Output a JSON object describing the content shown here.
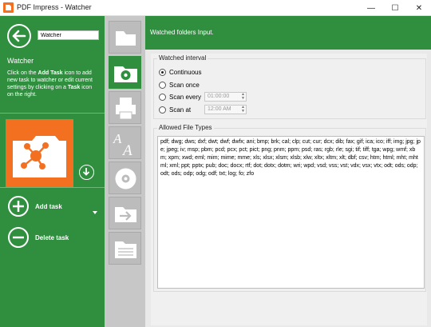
{
  "window": {
    "title": "PDF Impress - Watcher",
    "minimize_glyph": "—",
    "maximize_glyph": "☐",
    "close_glyph": "✕"
  },
  "sidebar": {
    "search_value": "Watcher",
    "title": "Watcher",
    "help": {
      "p1": "Click on the ",
      "add_task": "Add Task",
      "p2": " icon to add new task to watcher or edit current settings by clicking on a ",
      "task": "Task",
      "p3": " icon on the right."
    },
    "actions": [
      {
        "label": "Add task",
        "icon": "plus-icon"
      },
      {
        "label": "Delete task",
        "icon": "minus-icon"
      }
    ]
  },
  "rail": {
    "items": [
      {
        "name": "folder",
        "active": false
      },
      {
        "name": "settings",
        "active": true
      },
      {
        "name": "print",
        "active": false
      },
      {
        "name": "font",
        "active": false
      },
      {
        "name": "disc",
        "active": false
      },
      {
        "name": "export",
        "active": false
      },
      {
        "name": "list",
        "active": false
      }
    ]
  },
  "main": {
    "header": "Watched folders Input.",
    "interval": {
      "title": "Watched interval",
      "options": [
        {
          "label": "Continuous",
          "selected": true
        },
        {
          "label": "Scan once",
          "selected": false
        },
        {
          "label": "Scan every",
          "selected": false,
          "value": "01:00:00"
        },
        {
          "label": "Scan at",
          "selected": false,
          "value": "12:00 AM"
        }
      ]
    },
    "filetypes": {
      "title": "Allowed File Types",
      "value": "pdf; dwg; dws; dxf; dwt; dwf; dwfx; ani; bmp; brk; cal; clp; cut; cur; dcx; dib; fax; gif; ica; ico; iff; img; jpg; jpe; jpeg; iv; msp; pbm; pcd; pcx; pct; pict; png; pnm; ppm; psd; ras; rgb; rle; sgi; tif; tiff; tga; wpg; wmf; xbm; xpm; xwd; eml; mim; mime; mme; xls; xlsx; xlsm; xlsb; xlw; xltx; xltm; xlt; dbf; csv; htm; html; mht; mhtml; xml; ppt; pptx; pub; doc; docx; rtf; dot; dotx; dotm; wri; wpd; vsd; vss; vst; vdx; vsx; vtx; odt; ods; odp; odt; ods; odp; odg; odf; txt; log; fo; zfo"
    }
  },
  "colors": {
    "accent": "#2f8f3f",
    "brand": "#f37021"
  }
}
